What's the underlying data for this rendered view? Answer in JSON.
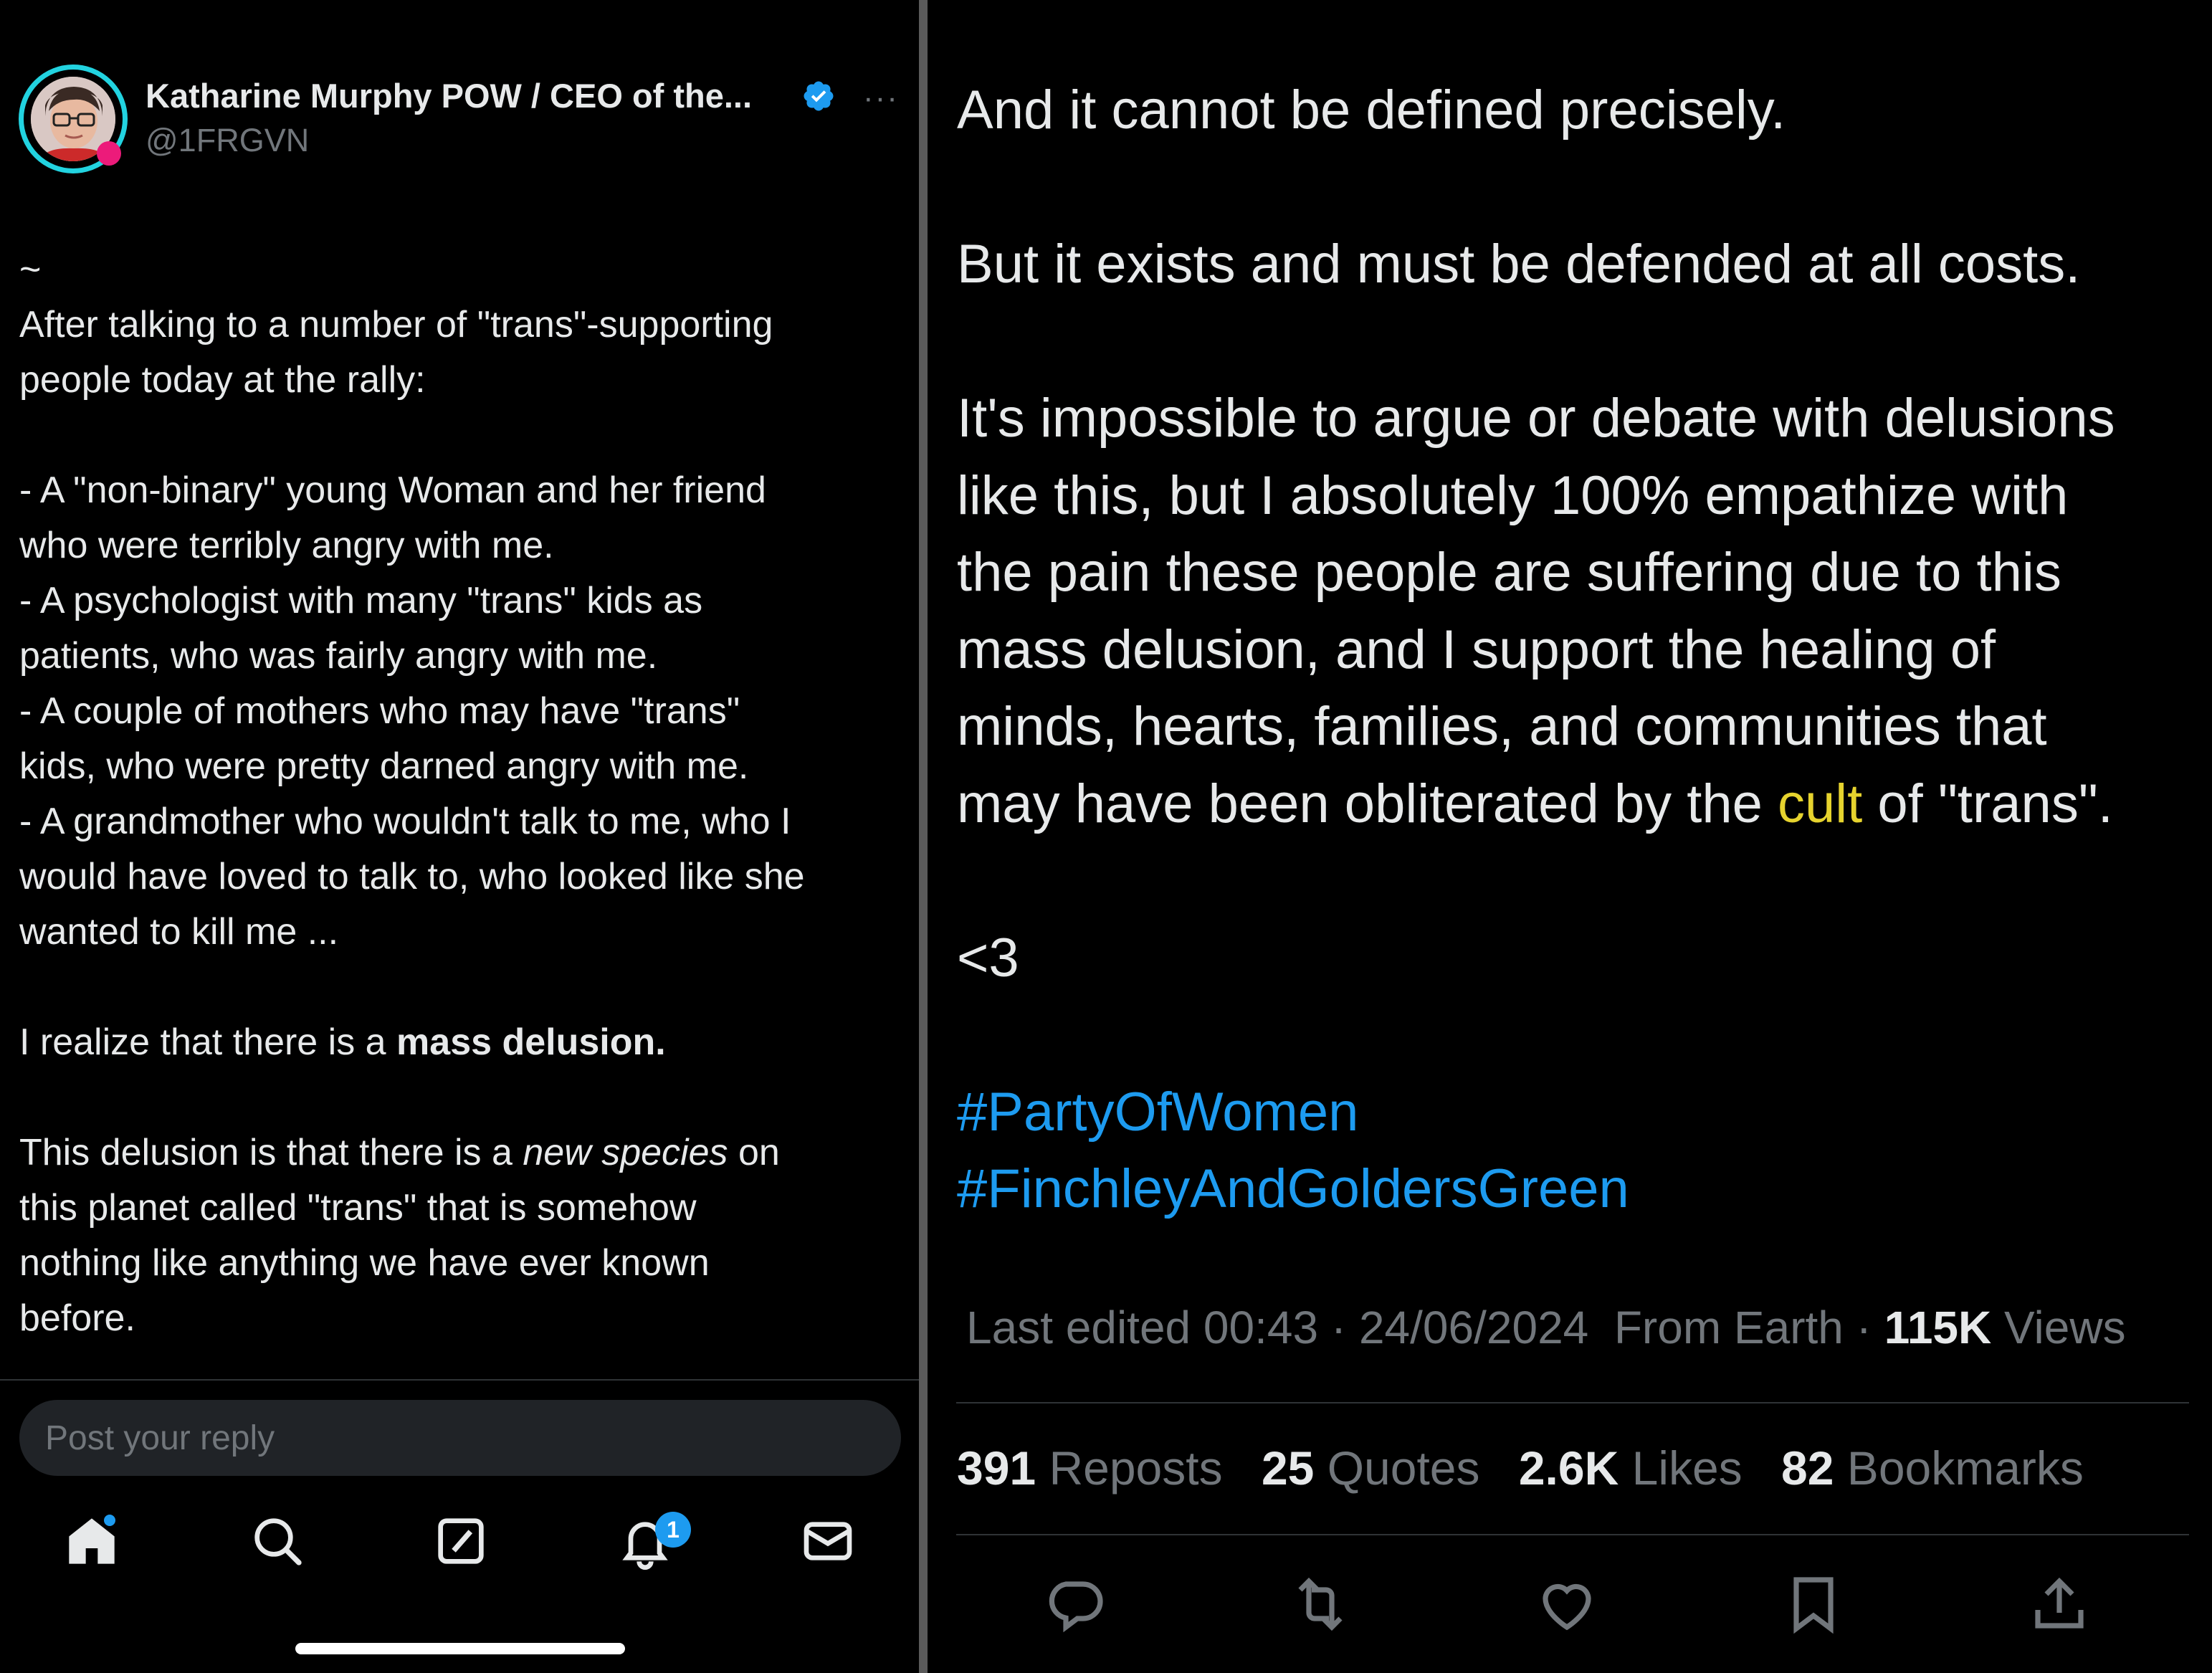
{
  "author": {
    "display_name": "Katharine Murphy POW / CEO of the...",
    "handle": "@1FRGVN",
    "verified": true,
    "more_label": "···"
  },
  "left_post": {
    "tilde": "~",
    "intro": "After talking to a number of \"trans\"-supporting\npeople today at the rally:",
    "list": "- A \"non-binary\" young Woman and her friend\nwho were terribly angry with me.\n- A psychologist with many \"trans\" kids as\npatients, who was fairly angry with me.\n- A couple of mothers who may have \"trans\"\nkids, who were pretty darned angry with me.\n- A grandmother who wouldn't talk to me, who I\nwould have loved to talk to, who looked like she\nwanted to kill me ...",
    "realize_prefix": "I realize that there is a ",
    "realize_bold": "mass delusion.",
    "delusion_prefix": "This delusion is that there is a ",
    "delusion_italic": "new species",
    "delusion_suffix": " on\nthis planet called \"trans\" that is somehow\nnothing like anything we have ever known\nbefore."
  },
  "reply": {
    "placeholder": "Post your reply"
  },
  "tabbar": {
    "items": [
      {
        "name": "home-icon",
        "active": true
      },
      {
        "name": "search-icon"
      },
      {
        "name": "compose-icon"
      },
      {
        "name": "notifications-icon",
        "badge": "1"
      },
      {
        "name": "messages-icon"
      }
    ]
  },
  "right_post": {
    "p1": "And it cannot be defined precisely.",
    "p2": "But it exists and must be defended at all costs.",
    "p3_main": "It's impossible to argue or debate with delusions\nlike this, but I absolutely 100% empathize with\nthe pain these people are suffering due to this\nmass delusion, and I support the healing of\nminds, hearts, families, and communities that\nmay have been obliterated by the ",
    "p3_cult": "cult",
    "p3_end": " of \"trans\".",
    "heart": "<3",
    "hashtag1": "#PartyOfWomen",
    "hashtag2": "#FinchleyAndGoldersGreen"
  },
  "meta": {
    "edited": "Last edited 00:43 · 24/06/2024",
    "source": "From Earth",
    "dot": "·",
    "views_count": "115K",
    "views_label": "Views"
  },
  "stats": {
    "reposts_count": "391",
    "reposts_label": "Reposts",
    "quotes_count": "25",
    "quotes_label": "Quotes",
    "likes_count": "2.6K",
    "likes_label": "Likes",
    "bookmarks_count": "82",
    "bookmarks_label": "Bookmarks"
  },
  "actions": [
    "reply-icon",
    "repost-icon",
    "like-icon",
    "bookmark-icon",
    "share-icon"
  ],
  "colors": {
    "accent": "#1d9bf0",
    "highlight": "#e6d32e",
    "avatar_ring": "#22d3e0"
  }
}
